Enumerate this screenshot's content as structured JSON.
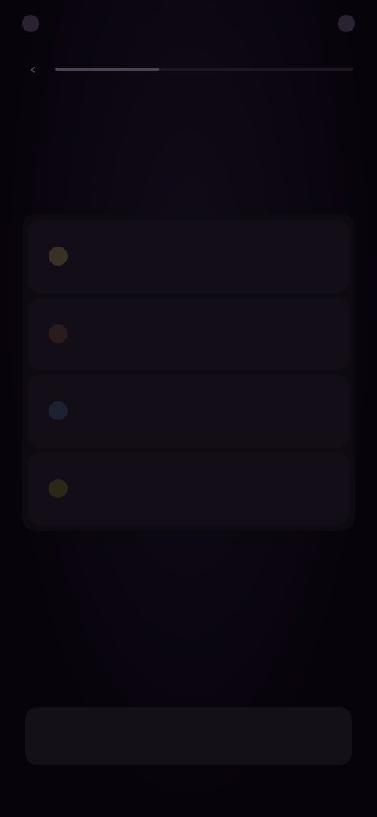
{
  "status_bar": {
    "time": ""
  },
  "header": {
    "progress_percent": 35
  },
  "question": {
    "text": ""
  },
  "options": [
    {
      "label": "",
      "icon": "sun-icon",
      "color": "#3a3024"
    },
    {
      "label": "",
      "icon": "fire-icon",
      "color": "#2a1c1c"
    },
    {
      "label": "",
      "icon": "globe-icon",
      "color": "#1c2232"
    },
    {
      "label": "",
      "icon": "star-icon",
      "color": "#2c2818"
    }
  ],
  "footer": {
    "continue_label": ""
  },
  "colors": {
    "background": "#07030b",
    "card": "#0e0a12",
    "option": "#120d16"
  }
}
